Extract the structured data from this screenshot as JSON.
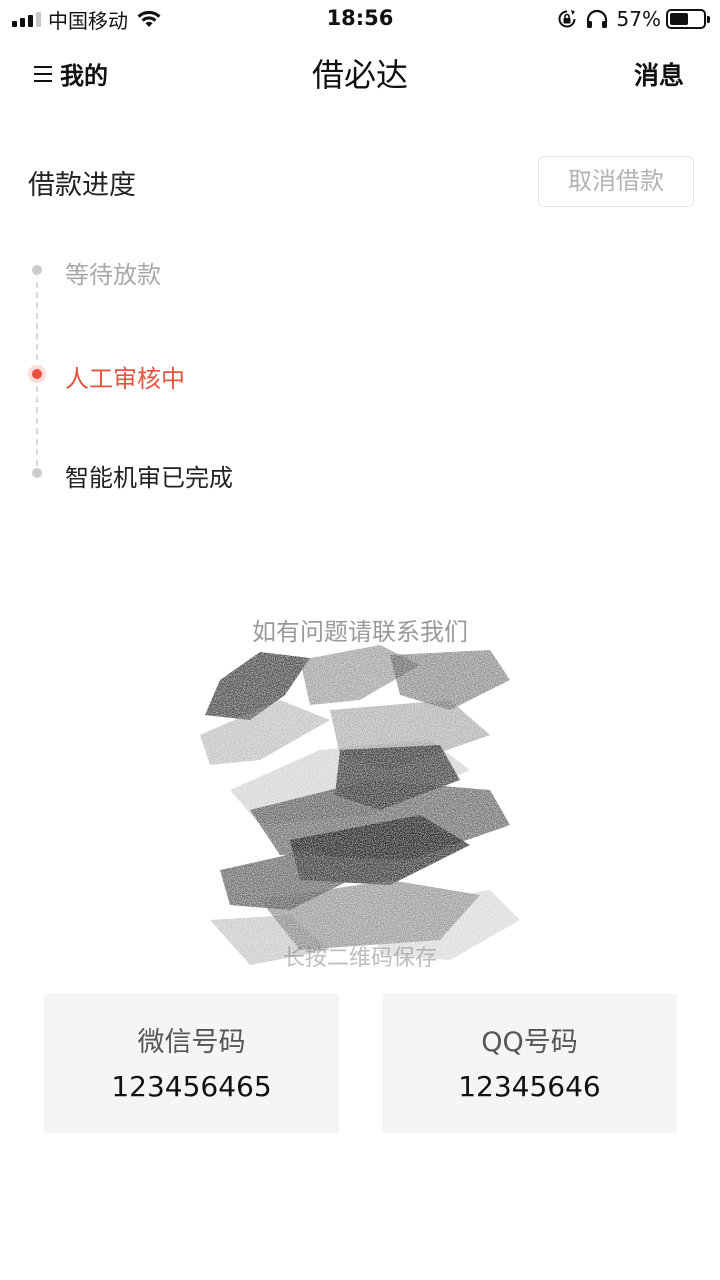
{
  "status_bar": {
    "carrier": "中国移动",
    "time": "18:56",
    "battery_percent": "57%",
    "battery_level": 0.57
  },
  "nav": {
    "menu_label": "我的",
    "title": "借必达",
    "messages_label": "消息"
  },
  "progress": {
    "title": "借款进度",
    "cancel_label": "取消借款",
    "steps": [
      {
        "label": "等待放款",
        "state": "pending"
      },
      {
        "label": "人工审核中",
        "state": "active"
      },
      {
        "label": "智能机审已完成",
        "state": "done"
      }
    ]
  },
  "contact": {
    "title": "如有问题请联系我们",
    "qr_caption": "长按二维码保存",
    "wechat_label": "微信号码",
    "wechat_value": "123456465",
    "qq_label": "QQ号码",
    "qq_value": "12345646"
  },
  "colors": {
    "accent": "#e8533f",
    "muted": "#a8a8a8",
    "card_bg": "#f5f5f5"
  }
}
